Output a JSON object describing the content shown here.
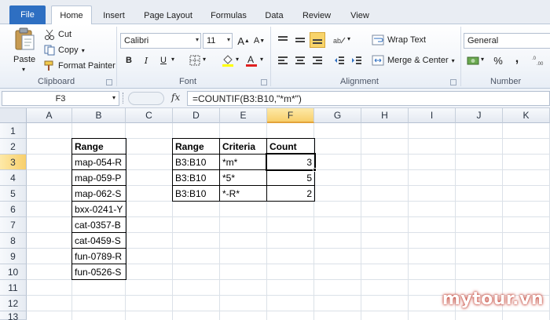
{
  "tabs": {
    "file": "File",
    "items": [
      "Home",
      "Insert",
      "Page Layout",
      "Formulas",
      "Data",
      "Review",
      "View"
    ],
    "active": "Home"
  },
  "ribbon": {
    "clipboard": {
      "label": "Clipboard",
      "paste": "Paste",
      "cut": "Cut",
      "copy": "Copy",
      "format_painter": "Format Painter"
    },
    "font": {
      "label": "Font",
      "family": "Calibri",
      "size": "11",
      "bold": "B",
      "italic": "I",
      "underline": "U",
      "grow": "A",
      "shrink": "A"
    },
    "alignment": {
      "label": "Alignment",
      "wrap_text": "Wrap Text",
      "merge_center": "Merge & Center"
    },
    "number": {
      "label": "Number",
      "format": "General",
      "percent": "%",
      "comma": ","
    }
  },
  "formula_bar": {
    "name_box": "F3",
    "fx": "fx",
    "formula": "=COUNTIF(B3:B10,\"*m*\")"
  },
  "sheet": {
    "columns": [
      "A",
      "B",
      "C",
      "D",
      "E",
      "F",
      "G",
      "H",
      "I",
      "J",
      "K"
    ],
    "rows": [
      "1",
      "2",
      "3",
      "4",
      "5",
      "6",
      "7",
      "8",
      "9",
      "10",
      "11",
      "12",
      "13"
    ],
    "selected_column": "F",
    "selected_row": "3",
    "range_table": {
      "header": "Range",
      "values": [
        "map-054-R",
        "map-059-P",
        "map-062-S",
        "bxx-0241-Y",
        "cat-0357-B",
        "cat-0459-S",
        "fun-0789-R",
        "fun-0526-S"
      ]
    },
    "count_table": {
      "headers": [
        "Range",
        "Criteria",
        "Count"
      ],
      "rows": [
        [
          "B3:B10",
          "*m*",
          "3"
        ],
        [
          "B3:B10",
          "*5*",
          "5"
        ],
        [
          "B3:B10",
          "*-R*",
          "2"
        ]
      ]
    }
  },
  "watermark": "mytour.vn",
  "colors": {
    "file_tab": "#2e6fc2",
    "selection_header": "#f8cf6b",
    "watermark": "#c0392b"
  }
}
